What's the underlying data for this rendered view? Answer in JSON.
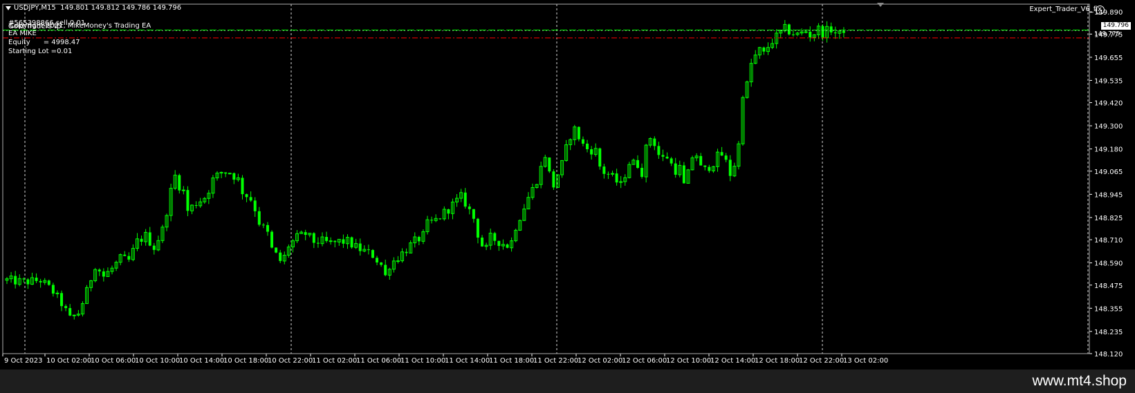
{
  "header": {
    "symbol_line": "USDJPY,M15  149.801 149.812 149.786 149.796",
    "ea_name": "Expert_Trader_V6_fix",
    "overlay_line1": "#565398866 sell 0.01",
    "overlay_line2": "Gold Traders tp",
    "overlay_line3": "Copyright 2021, MikeMoney's Trading EA",
    "overlay_line4": "EA MIKE",
    "equity_label": "Equity",
    "equity_value": "= 4998.47",
    "starting_lot": "Starting Lot =0.01"
  },
  "current_price_label": "149.796",
  "second_price_label": "149.775",
  "watermark": "www.mt4.shop",
  "colors": {
    "background": "#000000",
    "candle": "#00ff00",
    "grid": "#ffffff",
    "bid_line": "#00ff00",
    "sell_line": "#ff0000",
    "text": "#ffffff"
  },
  "chart_data": {
    "type": "candlestick",
    "symbol": "USDJPY",
    "timeframe": "M15",
    "ylim": [
      148.12,
      149.93
    ],
    "y_ticks": [
      "149.890",
      "149.775",
      "149.655",
      "149.535",
      "149.420",
      "149.300",
      "149.180",
      "149.065",
      "148.945",
      "148.825",
      "148.710",
      "148.590",
      "148.475",
      "148.355",
      "148.235",
      "148.120"
    ],
    "y_tick_values": [
      149.89,
      149.775,
      149.655,
      149.535,
      149.42,
      149.3,
      149.18,
      149.065,
      148.945,
      148.825,
      148.71,
      148.59,
      148.475,
      148.355,
      148.235,
      148.12
    ],
    "x_ticks": [
      "9 Oct 2023",
      "10 Oct 02:00",
      "10 Oct 06:00",
      "10 Oct 10:00",
      "10 Oct 14:00",
      "10 Oct 18:00",
      "10 Oct 22:00",
      "11 Oct 02:00",
      "11 Oct 06:00",
      "11 Oct 10:00",
      "11 Oct 14:00",
      "11 Oct 18:00",
      "11 Oct 22:00",
      "12 Oct 02:00",
      "12 Oct 06:00",
      "12 Oct 10:00",
      "12 Oct 14:00",
      "12 Oct 18:00",
      "12 Oct 22:00",
      "13 Oct 02:00"
    ],
    "period_separators": [
      "10 Oct",
      "11 Oct",
      "12 Oct",
      "13 Oct"
    ],
    "bid_price": 149.796,
    "sell_order_price": 149.755,
    "price_path": [
      [
        0,
        148.5
      ],
      [
        4,
        148.49
      ],
      [
        8,
        148.5
      ],
      [
        11,
        148.44
      ],
      [
        13,
        148.38
      ],
      [
        15,
        148.3
      ],
      [
        17,
        148.33
      ],
      [
        19,
        148.44
      ],
      [
        21,
        148.58
      ],
      [
        23,
        148.52
      ],
      [
        25,
        148.56
      ],
      [
        27,
        148.61
      ],
      [
        29,
        148.6
      ],
      [
        31,
        148.7
      ],
      [
        33,
        148.73
      ],
      [
        35,
        148.67
      ],
      [
        37,
        148.76
      ],
      [
        38,
        148.86
      ],
      [
        39,
        148.96
      ],
      [
        40,
        149.04
      ],
      [
        41,
        148.99
      ],
      [
        42,
        148.96
      ],
      [
        43,
        148.86
      ],
      [
        45,
        148.9
      ],
      [
        47,
        148.93
      ],
      [
        48,
        148.97
      ],
      [
        49,
        149.02
      ],
      [
        51,
        149.06
      ],
      [
        53,
        149.06
      ],
      [
        55,
        149.02
      ],
      [
        56,
        148.96
      ],
      [
        58,
        148.92
      ],
      [
        59,
        148.87
      ],
      [
        60,
        148.8
      ],
      [
        62,
        148.74
      ],
      [
        63,
        148.66
      ],
      [
        65,
        148.6
      ],
      [
        66,
        148.62
      ],
      [
        67,
        148.68
      ],
      [
        69,
        148.72
      ],
      [
        71,
        148.74
      ],
      [
        73,
        148.7
      ],
      [
        75,
        148.7
      ],
      [
        77,
        148.69
      ],
      [
        79,
        148.7
      ],
      [
        81,
        148.7
      ],
      [
        83,
        148.67
      ],
      [
        85,
        148.65
      ],
      [
        87,
        148.63
      ],
      [
        89,
        148.58
      ],
      [
        90,
        148.52
      ],
      [
        91,
        148.58
      ],
      [
        93,
        148.62
      ],
      [
        95,
        148.66
      ],
      [
        97,
        148.7
      ],
      [
        99,
        148.73
      ],
      [
        100,
        148.79
      ],
      [
        102,
        148.81
      ],
      [
        104,
        148.85
      ],
      [
        106,
        148.89
      ],
      [
        108,
        148.93
      ],
      [
        109,
        148.9
      ],
      [
        111,
        148.82
      ],
      [
        112,
        148.74
      ],
      [
        113,
        148.68
      ],
      [
        114,
        148.66
      ],
      [
        115,
        148.72
      ],
      [
        117,
        148.7
      ],
      [
        119,
        148.68
      ],
      [
        120,
        148.7
      ],
      [
        121,
        148.78
      ],
      [
        122,
        148.83
      ],
      [
        123,
        148.88
      ],
      [
        124,
        148.93
      ],
      [
        125,
        148.97
      ],
      [
        126,
        149.02
      ],
      [
        127,
        149.08
      ],
      [
        128,
        149.15
      ],
      [
        129,
        149.05
      ],
      [
        130,
        148.99
      ],
      [
        131,
        149.05
      ],
      [
        132,
        149.1
      ],
      [
        133,
        149.18
      ],
      [
        134,
        149.25
      ],
      [
        135,
        149.28
      ],
      [
        136,
        149.24
      ],
      [
        137,
        149.2
      ],
      [
        138,
        149.18
      ],
      [
        140,
        149.17
      ],
      [
        141,
        149.09
      ],
      [
        142,
        149.06
      ],
      [
        143,
        149.05
      ],
      [
        144,
        149.03
      ],
      [
        145,
        149.01
      ],
      [
        146,
        148.99
      ],
      [
        147,
        149.05
      ],
      [
        148,
        149.11
      ],
      [
        150,
        149.1
      ],
      [
        151,
        149.06
      ],
      [
        152,
        149.18
      ],
      [
        153,
        149.24
      ],
      [
        154,
        149.21
      ],
      [
        155,
        149.15
      ],
      [
        156,
        149.13
      ],
      [
        157,
        149.14
      ],
      [
        158,
        149.1
      ],
      [
        159,
        149.07
      ],
      [
        160,
        149.08
      ],
      [
        161,
        148.99
      ],
      [
        162,
        149.05
      ],
      [
        163,
        149.14
      ],
      [
        164,
        149.15
      ],
      [
        165,
        149.08
      ],
      [
        166,
        149.07
      ],
      [
        167,
        149.09
      ],
      [
        168,
        149.11
      ],
      [
        169,
        149.14
      ],
      [
        170,
        149.15
      ],
      [
        171,
        149.11
      ],
      [
        172,
        149.05
      ],
      [
        173,
        149.1
      ],
      [
        174,
        149.2
      ],
      [
        175,
        149.47
      ],
      [
        176,
        149.51
      ],
      [
        177,
        149.62
      ],
      [
        178,
        149.66
      ],
      [
        179,
        149.69
      ],
      [
        180,
        149.67
      ],
      [
        181,
        149.71
      ],
      [
        182,
        149.74
      ],
      [
        183,
        149.76
      ],
      [
        184,
        149.78
      ],
      [
        185,
        149.8
      ],
      [
        186,
        149.79
      ],
      [
        187,
        149.78
      ],
      [
        188,
        149.77
      ],
      [
        189,
        149.78
      ],
      [
        190,
        149.79
      ],
      [
        191,
        149.77
      ],
      [
        192,
        149.78
      ],
      [
        193,
        149.8
      ],
      [
        194,
        149.78
      ],
      [
        195,
        149.79
      ],
      [
        196,
        149.8
      ],
      [
        197,
        149.78
      ],
      [
        198,
        149.77
      ],
      [
        199,
        149.8
      ]
    ]
  }
}
